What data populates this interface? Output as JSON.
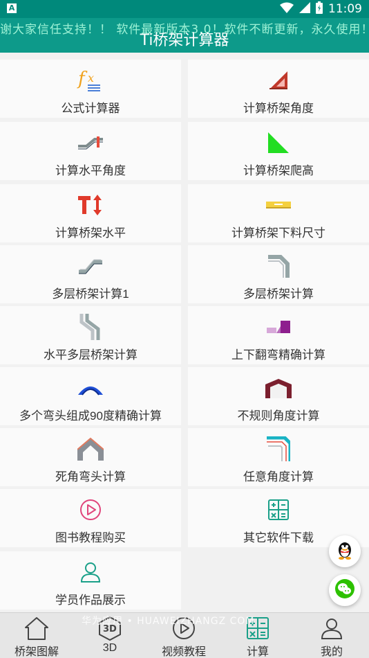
{
  "status": {
    "time": "11:09",
    "left_icon": "A"
  },
  "header": {
    "marquee": "谢大家信任支持！！ 软件最新版本3.0！软件不断更新，永久使用！谢",
    "title": "Ti桥架计算器"
  },
  "menu": [
    {
      "label": "公式计算器",
      "icon": "formula-icon"
    },
    {
      "label": "计算桥架角度",
      "icon": "angle-ruler-icon"
    },
    {
      "label": "计算水平角度",
      "icon": "horizontal-angle-icon"
    },
    {
      "label": "计算桥架爬高",
      "icon": "climb-triangle-icon"
    },
    {
      "label": "计算桥架水平",
      "icon": "level-text-icon"
    },
    {
      "label": "计算桥架下料尺寸",
      "icon": "cut-size-icon"
    },
    {
      "label": "多层桥架计算1",
      "icon": "multi-layer-stairs-icon"
    },
    {
      "label": "多层桥架计算",
      "icon": "multi-layer-elbow-icon"
    },
    {
      "label": "水平多层桥架计算",
      "icon": "horizontal-multi-layer-icon"
    },
    {
      "label": "上下翻弯精确计算",
      "icon": "up-down-bend-icon"
    },
    {
      "label": "多个弯头组成90度精确计算",
      "icon": "multi-elbow-90-icon"
    },
    {
      "label": "不规则角度计算",
      "icon": "irregular-angle-icon"
    },
    {
      "label": "死角弯头计算",
      "icon": "dead-angle-elbow-icon"
    },
    {
      "label": "任意角度计算",
      "icon": "arbitrary-angle-icon"
    },
    {
      "label": "图书教程购买",
      "icon": "play-circle-icon"
    },
    {
      "label": "其它软件下载",
      "icon": "calculator-icon"
    },
    {
      "label": "学员作品展示",
      "icon": "user-icon"
    }
  ],
  "tabs": [
    {
      "label": "桥架图解",
      "icon": "home-icon"
    },
    {
      "label": "3D",
      "icon": "3d-cube-icon"
    },
    {
      "label": "视频教程",
      "icon": "play-circle-icon"
    },
    {
      "label": "计算",
      "icon": "calculator-icon"
    },
    {
      "label": "我的",
      "icon": "user-icon"
    }
  ],
  "watermark": "华为应用 • HUAWEIZHANGZ COM",
  "colors": {
    "primary": "#0d9a8a",
    "accent_teal": "#1aa089",
    "pink": "#e0457b"
  }
}
